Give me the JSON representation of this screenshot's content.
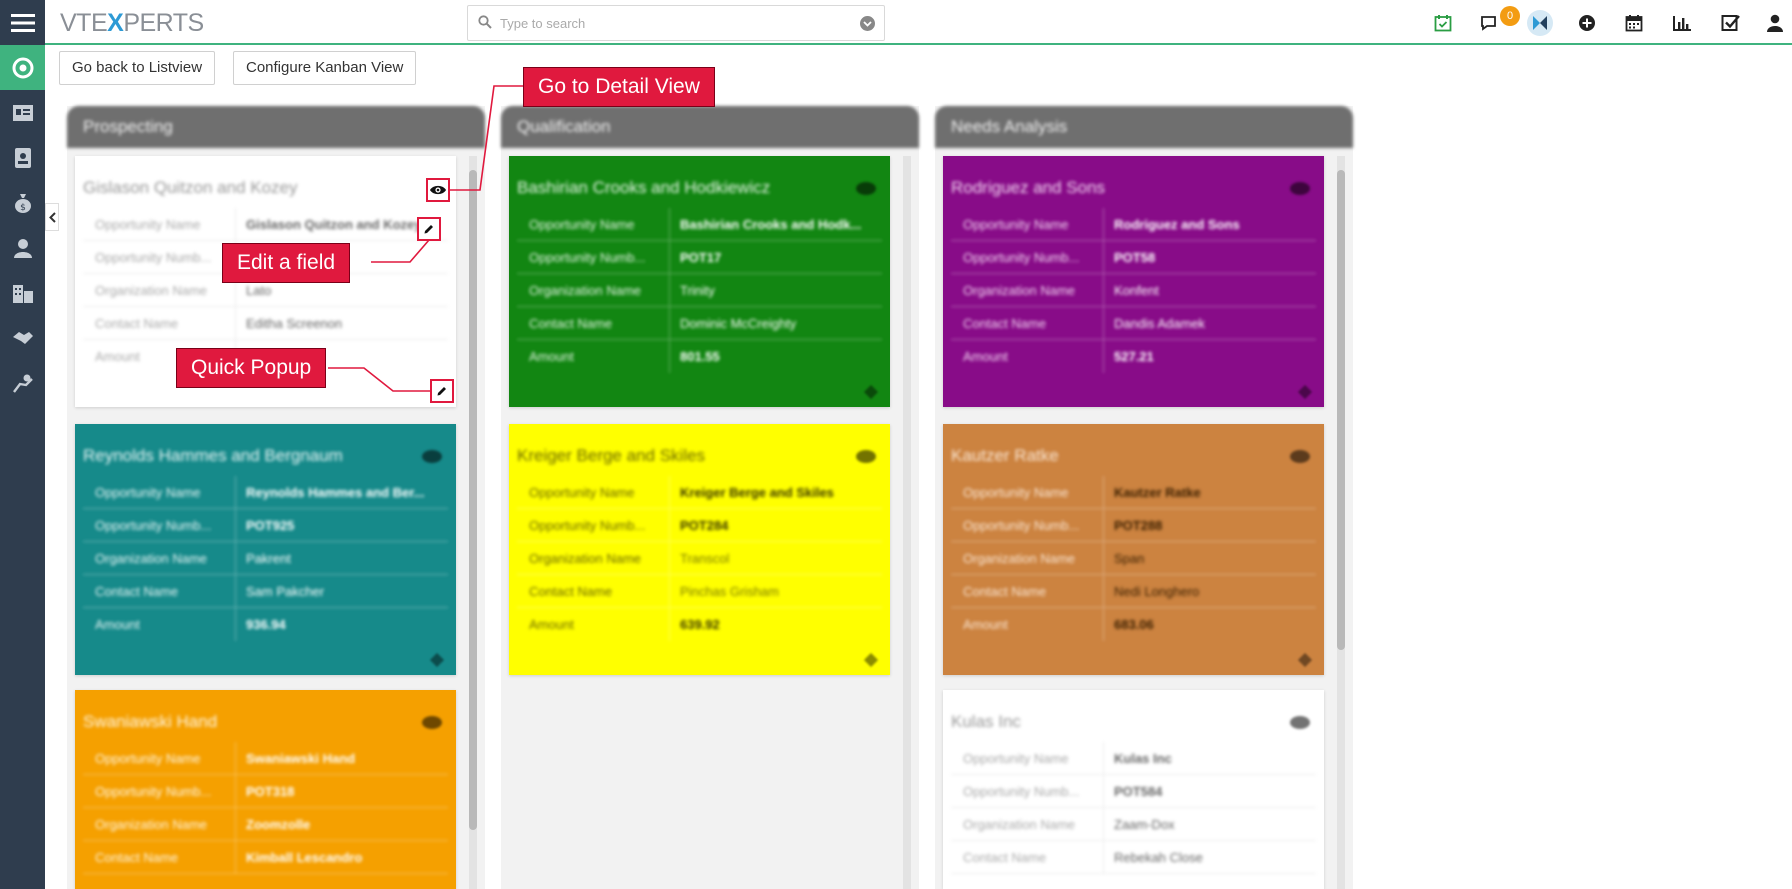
{
  "app": {
    "logo_left": "VTE",
    "logo_x": "X",
    "logo_right": "PERTS"
  },
  "search": {
    "placeholder": "Type to search"
  },
  "topbar": {
    "notification_count": "0"
  },
  "actions": {
    "back_label": "Go back to Listview",
    "configure_label": "Configure Kanban View"
  },
  "callouts": {
    "detail_view": "Go to Detail View",
    "edit_field": "Edit a field",
    "quick_popup": "Quick Popup"
  },
  "colors": {
    "accent": "#3fb37f",
    "sidebar": "#2f3d4e",
    "callout": "#e0193e"
  },
  "field_labels": {
    "opportunity_name": "Opportunity Name",
    "opportunity_number": "Opportunity Numb...",
    "organization_name": "Organization Name",
    "contact_name": "Contact Name",
    "amount": "Amount"
  },
  "columns": [
    {
      "title": "Prospecting",
      "cards": [
        {
          "title": "Gislason Quitzon and Kozey",
          "opportunity_name": "Gislason Quitzon and Kozey",
          "opportunity_number": "",
          "organization_name": "Lato",
          "contact_name": "Editha Screenon",
          "amount": ""
        },
        {
          "title": "Reynolds Hammes and Bergnaum",
          "opportunity_name": "Reynolds Hammes and Ber...",
          "opportunity_number": "POT925",
          "organization_name": "Pakrent",
          "contact_name": "Sam Pakcher",
          "amount": "936.94"
        },
        {
          "title": "Swaniawski Hand",
          "opportunity_name": "Swaniawski Hand",
          "opportunity_number": "POT318",
          "organization_name": "Zoomzolle",
          "contact_name": "Kimball Lescandro"
        }
      ]
    },
    {
      "title": "Qualification",
      "cards": [
        {
          "title": "Bashirian Crooks and Hodkiewicz",
          "opportunity_name": "Bashirian Crooks and Hodk...",
          "opportunity_number": "POT17",
          "organization_name": "Trinity",
          "contact_name": "Dominic McCreighty",
          "amount": "801.55"
        },
        {
          "title": "Kreiger Berge and Skiles",
          "opportunity_name": "Kreiger Berge and Skiles",
          "opportunity_number": "POT284",
          "organization_name": "Transcol",
          "contact_name": "Pinchas Grisham",
          "amount": "639.92"
        }
      ]
    },
    {
      "title": "Needs Analysis",
      "cards": [
        {
          "title": "Rodriguez and Sons",
          "opportunity_name": "Rodriguez and Sons",
          "opportunity_number": "POT58",
          "organization_name": "Konfent",
          "contact_name": "Dandis Adamek",
          "amount": "527.21"
        },
        {
          "title": "Kautzer Ratke",
          "opportunity_name": "Kautzer Ratke",
          "opportunity_number": "POT288",
          "organization_name": "Span",
          "contact_name": "Nedi Longhero",
          "amount": "683.06"
        },
        {
          "title": "Kulas Inc",
          "opportunity_name": "Kulas Inc",
          "opportunity_number": "POT584",
          "organization_name": "Zaam-Dox",
          "contact_name": "Rebekah Close"
        }
      ]
    }
  ]
}
